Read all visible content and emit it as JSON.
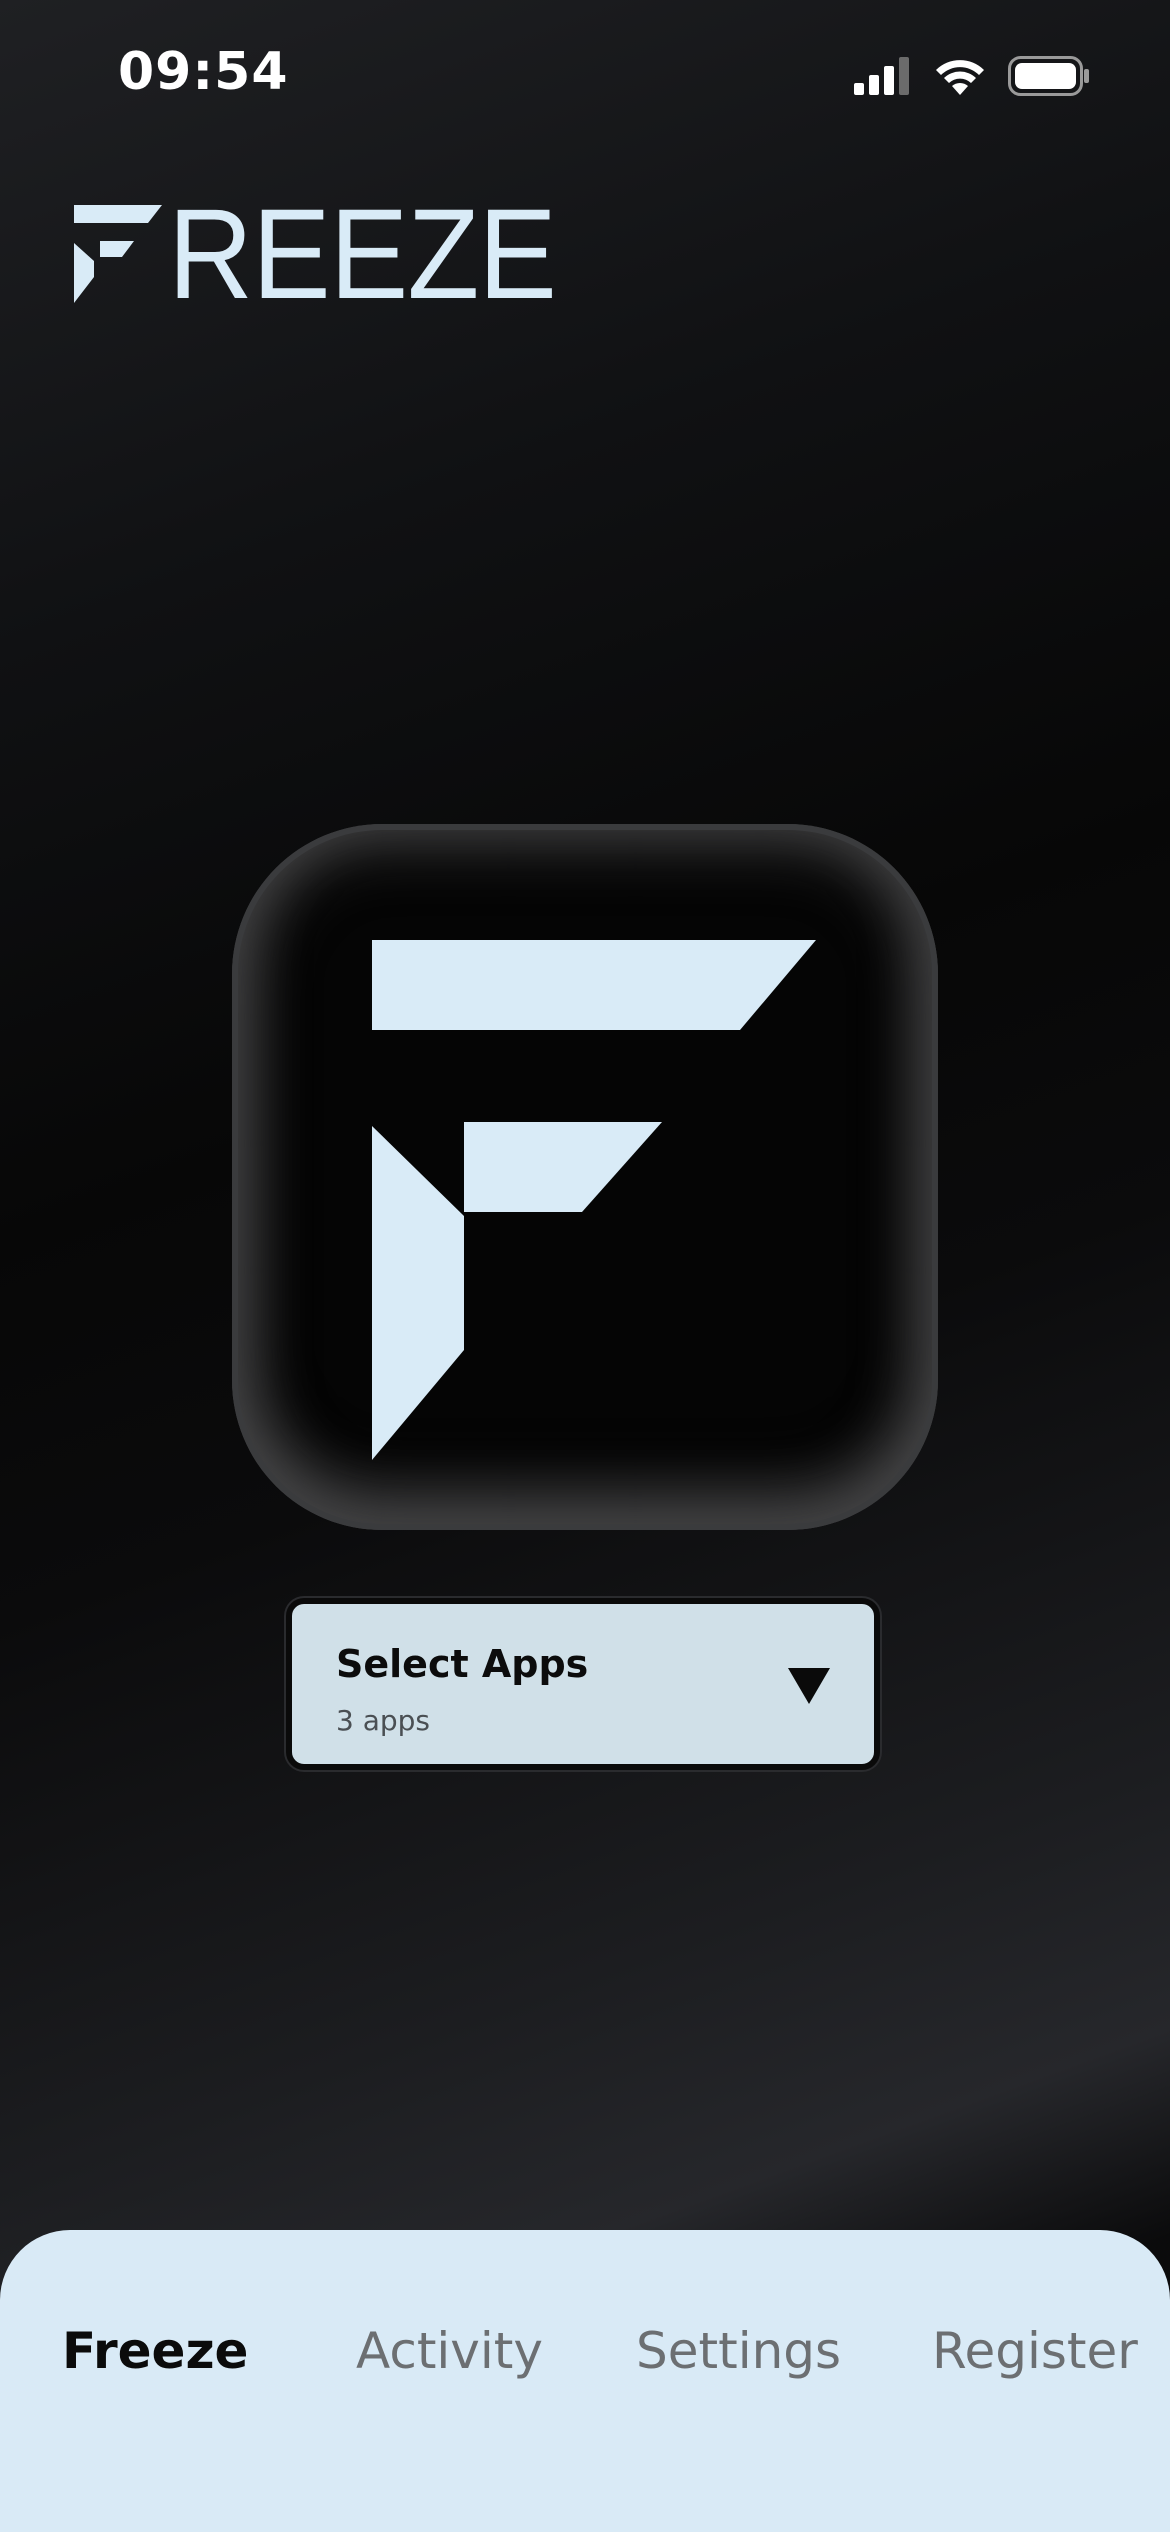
{
  "status_bar": {
    "time": "09:54",
    "icons": [
      "cellular-signal-icon",
      "wifi-icon",
      "battery-icon"
    ]
  },
  "brand": {
    "wordmark": "REEZE",
    "logo_icon": "freeze-f-logo-icon",
    "color": "#d9ebf7"
  },
  "main": {
    "logo_icon": "freeze-f-logo-icon",
    "select_apps": {
      "title": "Select Apps",
      "subtitle": "3 apps",
      "caret_icon": "caret-down-icon"
    }
  },
  "tabs": [
    {
      "label": "Freeze",
      "active": true
    },
    {
      "label": "Activity",
      "active": false
    },
    {
      "label": "Settings",
      "active": false
    },
    {
      "label": "Register",
      "active": false
    }
  ],
  "colors": {
    "accent": "#d9ebf7",
    "tab_bar_bg": "#d9eaf6",
    "dropdown_bg": "#d0e0e8",
    "inactive_tab": "#6c6f72"
  }
}
